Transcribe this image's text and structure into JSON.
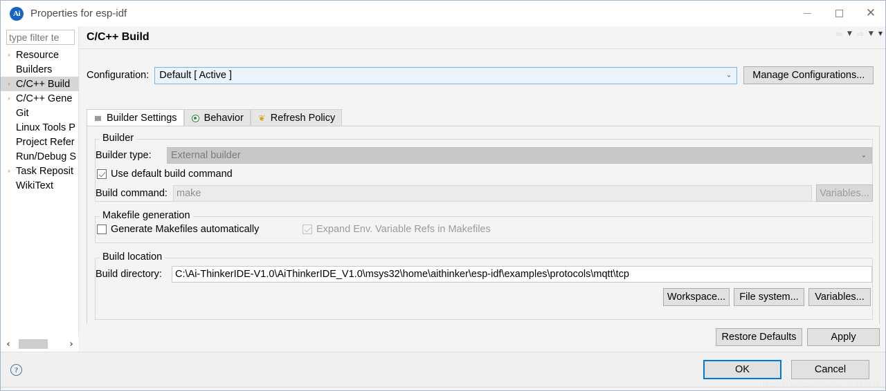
{
  "window": {
    "title": "Properties for esp-idf",
    "logo_text": "Ai",
    "controls": {
      "minimize": "minimize-icon",
      "maximize": "maximize-icon",
      "close": "close-icon",
      "close_glyph": "✕"
    }
  },
  "sidebar": {
    "filter_placeholder": "type filter te",
    "filter_value": "",
    "items": [
      {
        "label": "Resource",
        "expandable": true,
        "selected": false
      },
      {
        "label": "Builders",
        "expandable": false,
        "selected": false
      },
      {
        "label": "C/C++ Build",
        "expandable": true,
        "selected": true
      },
      {
        "label": "C/C++ Gene",
        "expandable": true,
        "selected": false
      },
      {
        "label": "Git",
        "expandable": false,
        "selected": false
      },
      {
        "label": "Linux Tools P",
        "expandable": false,
        "selected": false
      },
      {
        "label": "Project Refer",
        "expandable": false,
        "selected": false
      },
      {
        "label": "Run/Debug S",
        "expandable": false,
        "selected": false
      },
      {
        "label": "Task Reposit",
        "expandable": true,
        "selected": false
      },
      {
        "label": "WikiText",
        "expandable": false,
        "selected": false
      }
    ],
    "scroll_left": "‹",
    "scroll_right": "›"
  },
  "page": {
    "title": "C/C++ Build",
    "nav": {
      "back": "⇦",
      "back_menu": "▼",
      "forward": "⇨",
      "forward_menu": "▼",
      "view_menu": "▼"
    }
  },
  "configuration": {
    "label": "Configuration:",
    "value": "Default  [ Active ]",
    "arrow": "⌄",
    "manage_button": "Manage Configurations..."
  },
  "tabs": [
    {
      "label": "Builder Settings",
      "icon": "list-icon",
      "active": true
    },
    {
      "label": "Behavior",
      "icon": "radio-icon",
      "active": false
    },
    {
      "label": "Refresh Policy",
      "icon": "refresh-icon",
      "icon_glyph": "❦",
      "active": false
    }
  ],
  "builder_group": {
    "title": "Builder",
    "builder_type_label": "Builder type:",
    "builder_type_value": "External builder",
    "builder_type_arrow": "⌄",
    "use_default_label": "Use default build command",
    "use_default_checked": true,
    "build_command_label": "Build command:",
    "build_command_value": "make",
    "variables_button": "Variables..."
  },
  "makefile_group": {
    "title": "Makefile generation",
    "generate_label": "Generate Makefiles automatically",
    "generate_checked": false,
    "expand_label": "Expand Env. Variable Refs in Makefiles",
    "expand_checked": true
  },
  "build_location_group": {
    "title": "Build location",
    "directory_label": "Build directory:",
    "directory_value": "C:\\Ai-ThinkerIDE-V1.0\\AiThinkerIDE_V1.0\\msys32\\home\\aithinker\\esp-idf\\examples\\protocols\\mqtt\\tcp",
    "workspace_button": "Workspace...",
    "filesystem_button": "File system...",
    "variables_button": "Variables..."
  },
  "page_buttons": {
    "restore_defaults": "Restore Defaults",
    "apply": "Apply"
  },
  "dialog_buttons": {
    "help": "?",
    "ok": "OK",
    "cancel": "Cancel"
  },
  "watermark": "https://blog.csdn.net/qq_37977847",
  "colors": {
    "accent": "#0078d7",
    "combo_border": "#7eb4e2",
    "combo_bg": "#eaf2fb",
    "selection": "#d6d6d6",
    "logo": "#1565c0"
  }
}
